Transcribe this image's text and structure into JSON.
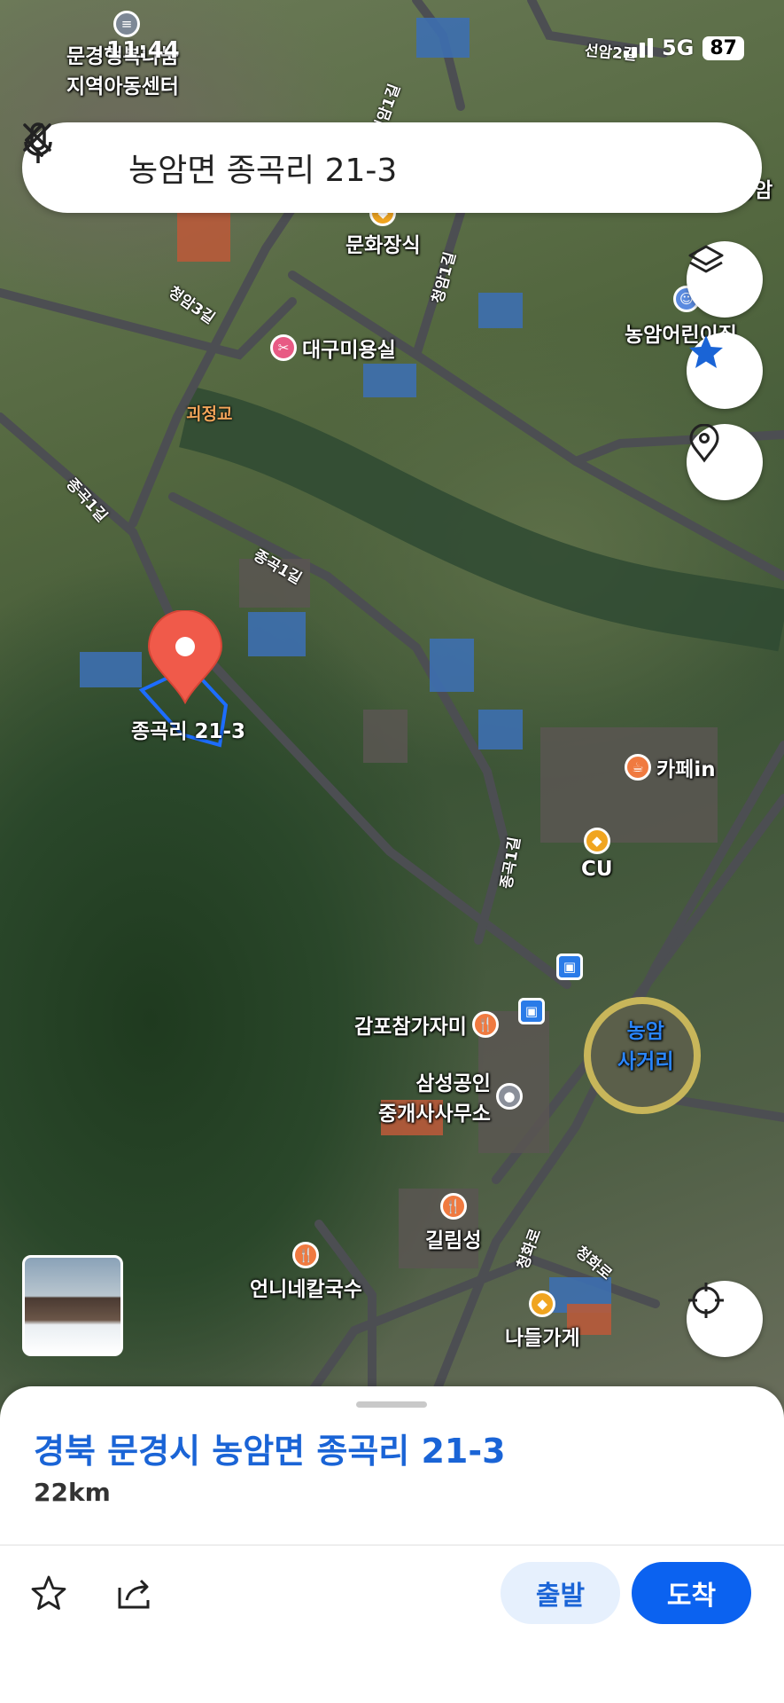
{
  "status_bar": {
    "time": "11:44",
    "network": "5G",
    "battery": "87"
  },
  "search": {
    "query": "농암면 종곡리 21-3"
  },
  "map": {
    "pin_label": "종곡리 21-3",
    "pois": [
      {
        "name": "문경아동센터 지역아동센터 line1",
        "text": "문경행복나눔"
      },
      {
        "name": "지역아동센터",
        "text": "지역아동센터"
      },
      {
        "name": "문화장식",
        "text": "문화장식"
      },
      {
        "name": "대구미용실",
        "text": "대구미용실"
      },
      {
        "name": "농암어린이집",
        "text": "농암어린이집"
      },
      {
        "name": "카페in",
        "text": "카페in"
      },
      {
        "name": "CU",
        "text": "CU"
      },
      {
        "name": "감포참가자미",
        "text": "감포참가자미"
      },
      {
        "name": "삼성공인 line1",
        "text": "삼성공인"
      },
      {
        "name": "삼성공인 line2",
        "text": "중개사사무소"
      },
      {
        "name": "길림성",
        "text": "길림성"
      },
      {
        "name": "언니네칼국수",
        "text": "언니네칼국수"
      },
      {
        "name": "나들가게",
        "text": "나들가게"
      },
      {
        "name": "농암사거리 line1",
        "text": "농암"
      },
      {
        "name": "농암사거리 line2",
        "text": "사거리"
      },
      {
        "name": "농암 top",
        "text": "농암"
      }
    ],
    "roads": {
      "r1": "청암3길",
      "r2": "청암1길",
      "r3": "종곡1길",
      "r4": "종곡1길",
      "r5": "종곡1길",
      "r6": "청화로",
      "r7": "청화로",
      "r8": "청암1길",
      "r9": "선암2길",
      "bridge": "괴정교"
    }
  },
  "sheet": {
    "address": "경북 문경시 농암면 종곡리 21-3",
    "distance": "22km",
    "start_label": "출발",
    "arrive_label": "도착"
  },
  "colors": {
    "accent": "#0b62f0",
    "pin": "#f05a4a",
    "address": "#1a64d6"
  }
}
